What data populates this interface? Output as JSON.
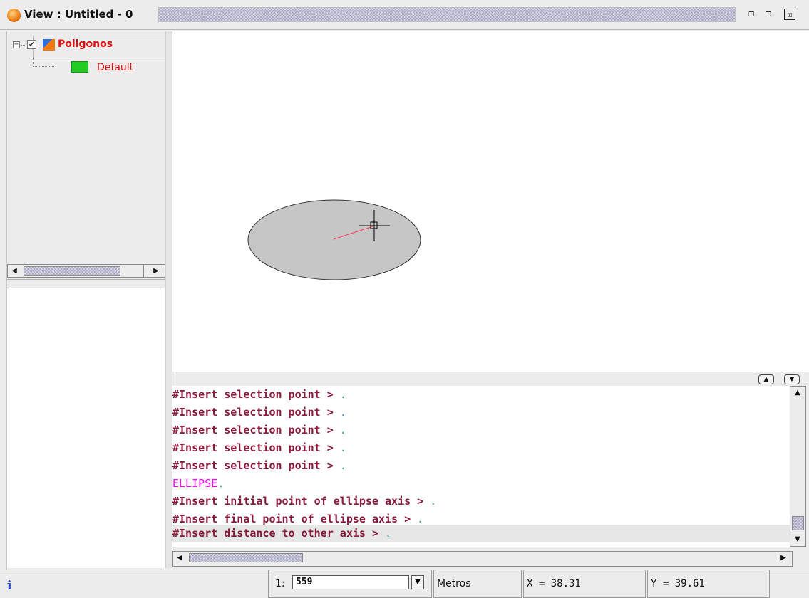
{
  "window": {
    "title": "View : Untitled - 0",
    "buttons": {
      "minimize": "❐",
      "maximize": "❐",
      "close": "☒"
    }
  },
  "toc": {
    "layer": {
      "name": "Poligonos",
      "checked": true,
      "expanded": true
    },
    "legend": {
      "label": "Default",
      "color": "#22cc22"
    }
  },
  "console": {
    "lines": [
      {
        "text": "#Insert selection point > ",
        "dot": ".",
        "type": "prompt"
      },
      {
        "text": "#Insert selection point > ",
        "dot": ".",
        "type": "prompt"
      },
      {
        "text": "#Insert selection point > ",
        "dot": ".",
        "type": "prompt"
      },
      {
        "text": "#Insert selection point > ",
        "dot": ".",
        "type": "prompt"
      },
      {
        "text": "#Insert selection point > ",
        "dot": ".",
        "type": "prompt"
      },
      {
        "text": "ELLIPSE",
        "dot": ".",
        "type": "command"
      },
      {
        "text": "#Insert initial point of ellipse axis > ",
        "dot": ".",
        "type": "prompt"
      },
      {
        "text": "#Insert final point of ellipse axis > ",
        "dot": ".",
        "type": "prompt"
      },
      {
        "text": "#Insert distance to other axis > ",
        "dot": ".",
        "type": "prompt-highlight"
      }
    ],
    "colors": {
      "prompt": "#8b1a3a",
      "command": "#ff00ff",
      "dot": "#2a9aa8"
    }
  },
  "status": {
    "info_icon": "i",
    "scale_prefix": "1:",
    "scale_value": "559",
    "units": "Metros",
    "x_readout": "X = 38.31",
    "y_readout": "Y = 39.61"
  }
}
